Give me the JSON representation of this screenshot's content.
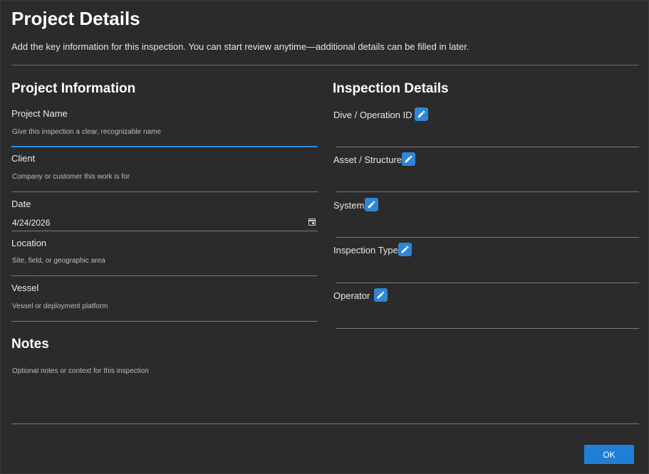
{
  "header": {
    "title": "Project Details",
    "subtitle": "Add the key information for this inspection. You can start review anytime—additional details can be filled in later."
  },
  "project_information": {
    "heading": "Project Information",
    "fields": [
      {
        "label": "Project Name",
        "placeholder": "Give this inspection a clear, recognizable name",
        "value": ""
      },
      {
        "label": "Client",
        "placeholder": "Company or customer this work is for",
        "value": ""
      },
      {
        "label": "Date",
        "value": "4/24/2026"
      },
      {
        "label": "Location",
        "placeholder": "Site, field, or geographic area",
        "value": ""
      },
      {
        "label": "Vessel",
        "placeholder": "Vessel or deployment platform",
        "value": ""
      }
    ]
  },
  "notes": {
    "heading": "Notes",
    "placeholder": "Optional notes or context for this inspection"
  },
  "inspection_details": {
    "heading": "Inspection Details",
    "fields": [
      {
        "label": "Dive / Operation ID",
        "icon": "pencil-icon"
      },
      {
        "label": "Asset / Structure",
        "icon": "pencil-icon"
      },
      {
        "label": "System",
        "icon": "pencil-icon"
      },
      {
        "label": "Inspection Type",
        "icon": "pencil-icon"
      },
      {
        "label": "Operator",
        "icon": "pencil-icon"
      }
    ]
  },
  "footer": {
    "ok_label": "OK"
  },
  "colors": {
    "background": "#2b2b2b",
    "accent": "#2d8ee8",
    "button": "#1f7fd6"
  }
}
